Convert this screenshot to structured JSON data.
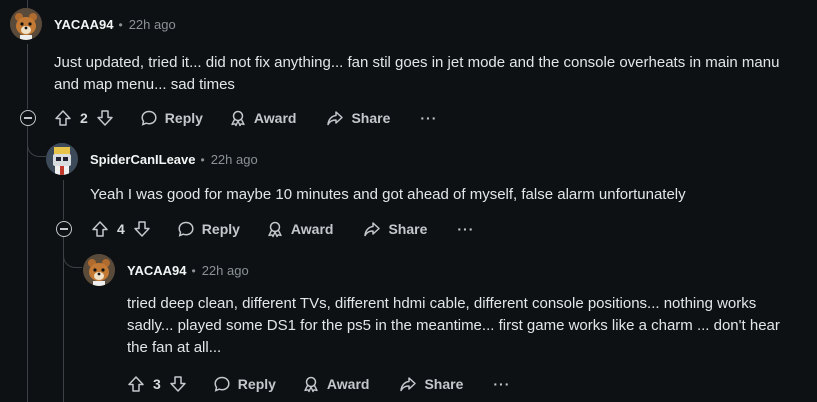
{
  "comments": [
    {
      "author": "YACAA94",
      "separator": "•",
      "time": "22h ago",
      "body": "Just updated, tried it... did not fix anything... fan stil goes in jet mode and the console overheats in main manu and map menu... sad times",
      "votes": "2",
      "reply_label": "Reply",
      "award_label": "Award",
      "share_label": "Share",
      "more_label": "···"
    },
    {
      "author": "SpiderCanILeave",
      "separator": "•",
      "time": "22h ago",
      "body": "Yeah I was good for maybe 10 minutes and got ahead of myself, false alarm unfortunately",
      "votes": "4",
      "reply_label": "Reply",
      "award_label": "Award",
      "share_label": "Share",
      "more_label": "···"
    },
    {
      "author": "YACAA94",
      "separator": "•",
      "time": "22h ago",
      "body": "tried deep clean, different TVs, different hdmi cable, different console positions... nothing works sadly... played some DS1 for the ps5 in the meantime... first game works like a charm ... don't hear the fan at all...",
      "votes": "3",
      "reply_label": "Reply",
      "award_label": "Award",
      "share_label": "Share",
      "more_label": "···"
    }
  ],
  "colors": {
    "background": "#0e1113",
    "text": "#e3e6e8",
    "muted": "#8a9297",
    "thread_line": "#3a4046"
  },
  "icons": [
    "upvote-icon",
    "downvote-icon",
    "reply-bubble-icon",
    "award-icon",
    "share-arrow-icon",
    "more-dots-icon",
    "collapse-minus-icon",
    "bear-avatar",
    "robot-avatar"
  ]
}
